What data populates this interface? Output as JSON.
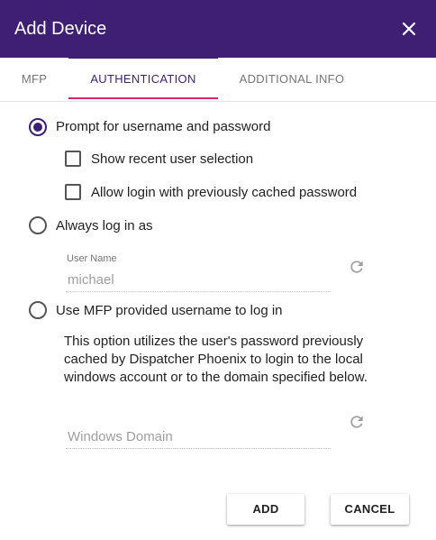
{
  "dialog": {
    "title": "Add Device",
    "close_icon": "close-icon"
  },
  "tabs": [
    {
      "label": "MFP",
      "active": false
    },
    {
      "label": "AUTHENTICATION",
      "active": true
    },
    {
      "label": "ADDITIONAL INFO",
      "active": false
    }
  ],
  "auth": {
    "prompt_option": {
      "label": "Prompt for username and password",
      "checked": true
    },
    "show_recent_checkbox": {
      "label": "Show recent user selection",
      "checked": false
    },
    "allow_cached_checkbox": {
      "label": "Allow login with previously cached password",
      "checked": false
    },
    "always_login_option": {
      "label": "Always log in as",
      "checked": false
    },
    "user_name_field": {
      "label": "User Name",
      "value": "michael"
    },
    "mfp_username_option": {
      "label": "Use MFP provided username to log in",
      "checked": false
    },
    "mfp_description": "This option utilizes the user's password previously cached by Dispatcher Phoenix to login to the local windows account or to the domain specified below.",
    "windows_domain_field": {
      "placeholder": "Windows Domain",
      "value": ""
    }
  },
  "buttons": {
    "add_label": "ADD",
    "cancel_label": "CANCEL"
  },
  "colors": {
    "header": "#3f1f73",
    "accent": "#3f1f73",
    "ink_bar": "#e91e63"
  }
}
